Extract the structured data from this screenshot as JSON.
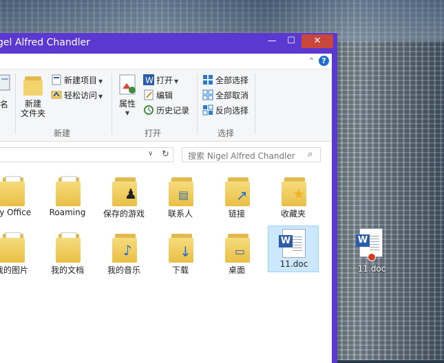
{
  "window": {
    "title": "gel Alfred Chandler",
    "controls": {
      "minimize": "—",
      "maximize": "☐",
      "close": "✕"
    },
    "help": "?"
  },
  "ribbon": {
    "partial_label": "命名",
    "new_folder": "新建\n文件夹",
    "new_item": "新建项目",
    "easy_access": "轻松访问",
    "group_new": "新建",
    "properties": "属性",
    "open": "打开",
    "edit": "编辑",
    "history": "历史记录",
    "group_open": "打开",
    "select_all": "全部选择",
    "select_none": "全部取消",
    "invert_selection": "反向选择",
    "group_select": "选择"
  },
  "search": {
    "placeholder": "搜索 Nigel Alfred Chandler"
  },
  "items": [
    {
      "label": "My Office"
    },
    {
      "label": "Roaming"
    },
    {
      "label": "保存的游戏"
    },
    {
      "label": "联系人"
    },
    {
      "label": "链接"
    },
    {
      "label": "收藏夹"
    },
    {
      "label": "我的图片"
    },
    {
      "label": "我的文档"
    },
    {
      "label": "我的音乐"
    },
    {
      "label": "下载"
    },
    {
      "label": "桌面"
    },
    {
      "label": "11.doc"
    }
  ],
  "desktop": {
    "file_label": "11.doc"
  },
  "colors": {
    "window_frame": "#5b38d0",
    "close_button": "#c9463d",
    "selection": "#cce8ff"
  }
}
